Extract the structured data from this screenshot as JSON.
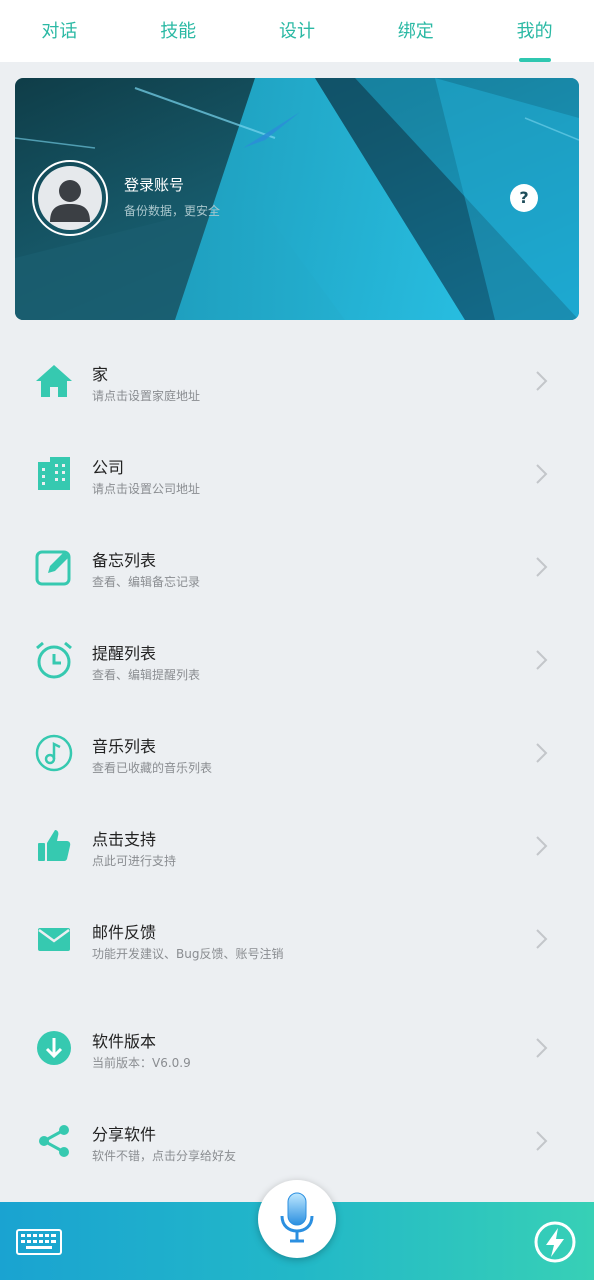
{
  "tabs": [
    {
      "label": "对话",
      "active": false
    },
    {
      "label": "技能",
      "active": false
    },
    {
      "label": "设计",
      "active": false
    },
    {
      "label": "绑定",
      "active": false
    },
    {
      "label": "我的",
      "active": true
    }
  ],
  "profile": {
    "title": "登录账号",
    "subtitle": "备份数据，更安全",
    "help_label": "?"
  },
  "menu": [
    {
      "title": "家",
      "subtitle": "请点击设置家庭地址",
      "icon": "home-icon"
    },
    {
      "title": "公司",
      "subtitle": "请点击设置公司地址",
      "icon": "building-icon"
    },
    {
      "title": "备忘列表",
      "subtitle": "查看、编辑备忘记录",
      "icon": "edit-note-icon"
    },
    {
      "title": "提醒列表",
      "subtitle": "查看、编辑提醒列表",
      "icon": "alarm-clock-icon"
    },
    {
      "title": "音乐列表",
      "subtitle": "查看已收藏的音乐列表",
      "icon": "music-note-icon"
    },
    {
      "title": "点击支持",
      "subtitle": "点此可进行支持",
      "icon": "thumbs-up-icon"
    },
    {
      "title": "邮件反馈",
      "subtitle": "功能开发建议、Bug反馈、账号注销",
      "icon": "mail-icon"
    },
    {
      "title": "软件版本",
      "subtitle": "当前版本：V6.0.9",
      "icon": "download-icon"
    },
    {
      "title": "分享软件",
      "subtitle": "软件不错，点击分享给好友",
      "icon": "share-icon"
    }
  ],
  "bottom_bar": {
    "left_icon": "keyboard-icon",
    "center_icon": "microphone-icon",
    "right_icon": "lightning-icon"
  },
  "colors": {
    "accent": "#2fc7b0",
    "background": "#eceff2"
  }
}
